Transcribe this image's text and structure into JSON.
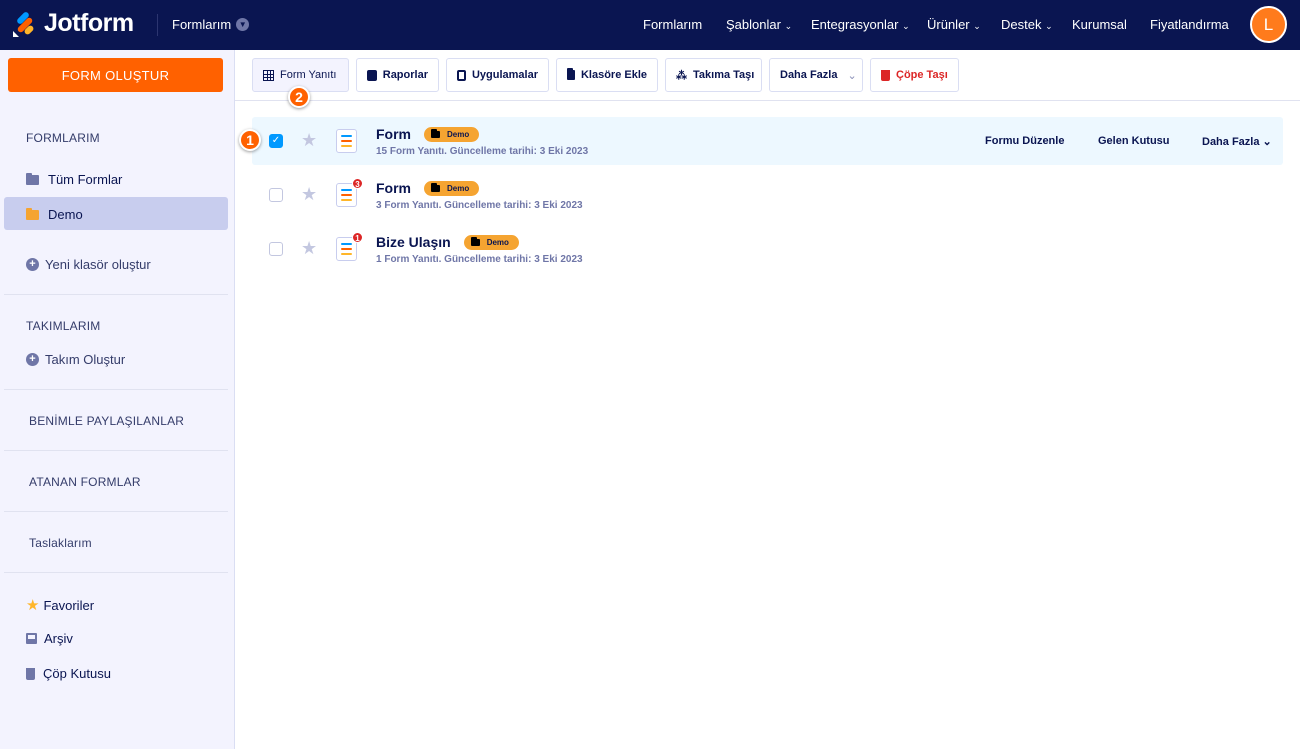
{
  "header": {
    "brand": "Jotform",
    "context": "Formlarım",
    "nav": [
      {
        "label": "Formlarım",
        "dropdown": false
      },
      {
        "label": "Şablonlar",
        "dropdown": true
      },
      {
        "label": "Entegrasyonlar",
        "dropdown": true
      },
      {
        "label": "Ürünler",
        "dropdown": true
      },
      {
        "label": "Destek",
        "dropdown": true
      },
      {
        "label": "Kurumsal",
        "dropdown": false
      },
      {
        "label": "Fiyatlandırma",
        "dropdown": false
      }
    ],
    "avatar_initial": "L"
  },
  "sidebar": {
    "create_label": "FORM OLUŞTUR",
    "my_forms_heading": "FORMLARIM",
    "all_forms": "Tüm Formlar",
    "demo": "Demo",
    "new_folder": "Yeni klasör oluştur",
    "teams_heading": "TAKIMLARIM",
    "create_team": "Takım Oluştur",
    "shared": "BENİMLE PAYLAŞILANLAR",
    "assigned": "ATANAN FORMLAR",
    "drafts": "Taslaklarım",
    "favorites": "Favoriler",
    "archive": "Arşiv",
    "trash": "Çöp Kutusu"
  },
  "toolbar": {
    "responses": "Form Yanıtı",
    "reports": "Raporlar",
    "apps": "Uygulamalar",
    "add_folder": "Klasöre Ekle",
    "move_team": "Takıma Taşı",
    "more": "Daha Fazla",
    "trash": "Çöpe Taşı"
  },
  "callouts": {
    "one": "1",
    "two": "2"
  },
  "forms": [
    {
      "title": "Form",
      "tag": "Demo",
      "subtitle": "15 Form Yanıtı. Güncelleme tarihi: 3 Eki 2023",
      "checked": true,
      "unread": ""
    },
    {
      "title": "Form",
      "tag": "Demo",
      "subtitle": "3 Form Yanıtı. Güncelleme tarihi: 3 Eki 2023",
      "checked": false,
      "unread": "3"
    },
    {
      "title": "Bize Ulaşın",
      "tag": "Demo",
      "subtitle": "1 Form Yanıtı. Güncelleme tarihi: 3 Eki 2023",
      "checked": false,
      "unread": "1"
    }
  ],
  "row_actions": {
    "edit": "Formu Düzenle",
    "inbox": "Gelen Kutusu",
    "more": "Daha Fazla"
  },
  "colors": {
    "navy": "#0a1551",
    "orange": "#ff6100",
    "tag": "#f5a431",
    "selected_row": "#edf8ff"
  }
}
